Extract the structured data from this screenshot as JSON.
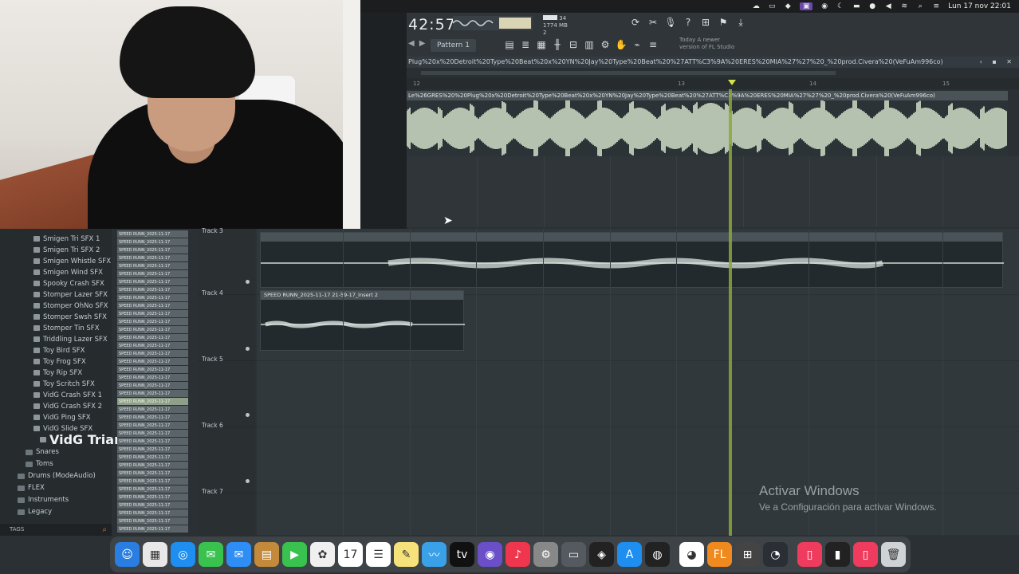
{
  "menubar": {
    "datetime": "Lun 17 nov  22:01"
  },
  "flheader": {
    "clock_main": "42:57",
    "clock_sub": "",
    "cpu_line1": "34",
    "cpu_line2": "1774 MB",
    "cpu_line3": "2",
    "pattern_label": "Pattern 1",
    "hint_line1": "Today A newer",
    "hint_line2": "version of FL Studio"
  },
  "editor": {
    "title": "Plug%20x%20Detroit%20Type%20Beat%20x%20YN%20Jay%20Type%20Beat%20%27ATT%C3%9A%20ERES%20MIA%27%27%20_%20prod.Civera%20(VeFuAm996co)",
    "clip_label": "Le%26GRES%20%20Plug%20x%20Detroit%20Type%20Beat%20x%20YN%20Jay%20Type%20Beat%20%27ATT%C3%9A%20ERES%20MIA%27%27%20_%20prod.Civera%20(VeFuAm996co)",
    "ruler": [
      "12",
      "13",
      "14",
      "15"
    ]
  },
  "browser": {
    "items": [
      "Smigen Tri SFX 1",
      "Smigen Tri SFX 2",
      "Smigen Whistle SFX",
      "Smigen Wind SFX",
      "Spooky Crash SFX",
      "Stomper Lazer SFX",
      "Stomper OhNo SFX",
      "Stomper Swsh SFX",
      "Stomper Tin SFX",
      "Triddling Lazer SFX",
      "Toy Bird SFX",
      "Toy Frog SFX",
      "Toy Rip SFX",
      "Toy Scritch SFX",
      "VidG Crash SFX 1",
      "VidG Crash SFX 2",
      "VidG Ping SFX",
      "VidG Slide SFX"
    ],
    "selected": "VidG Triangle SFX",
    "folders": [
      "Snares",
      "Toms"
    ],
    "top_folders": [
      "Drums (ModeAudio)",
      "FLEX",
      "Instruments",
      "Legacy"
    ],
    "tags": "TAGS"
  },
  "patterns": {
    "prefix": "SPEED RUNN_2025-11-17",
    "active": "SPEED RUNN_2025-11-17"
  },
  "tracks": {
    "labels": [
      "Track 3",
      "Track 4",
      "Track 5",
      "Track 6",
      "Track 7"
    ]
  },
  "playlist": {
    "clip1_label": "SPEED RUNN_2025-11-17 21-59-17_Insert 2",
    "clip_top_label": ""
  },
  "watermark": {
    "title": "Activar Windows",
    "subtitle": "Ve a Configuración para activar Windows."
  },
  "dock": {
    "apps": [
      "finder-icon",
      "launchpad-icon",
      "safari-icon",
      "messages-icon",
      "mail-icon",
      "maps-icon",
      "facetime-icon",
      "photos-icon",
      "calendar-icon",
      "reminders-icon",
      "notes-icon",
      "freeform-icon",
      "tv-icon",
      "podcasts-icon",
      "music-icon",
      "system-settings-icon",
      "screen-icon",
      "ai-icon",
      "appstore-icon",
      "chatgpt-icon",
      "chrome-icon",
      "fl-studio-icon",
      "calculator-icon",
      "utility-icon",
      "doc-icon",
      "doc2-icon",
      "doc3-icon",
      "trash-icon"
    ]
  },
  "colors": {
    "playhead": "#89a83a",
    "accent": "#6b49a8"
  }
}
